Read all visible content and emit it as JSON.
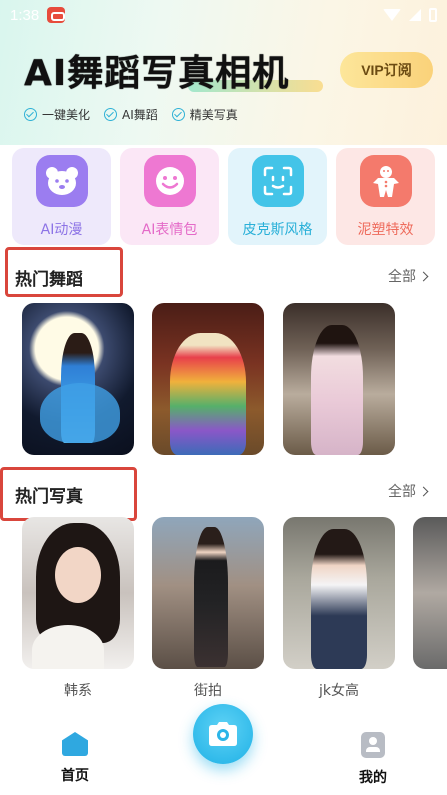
{
  "status_bar": {
    "time": "1:38"
  },
  "header": {
    "title": "AI舞蹈写真相机",
    "vip_label": "VIP订阅",
    "features": [
      "一键美化",
      "AI舞蹈",
      "精美写真"
    ]
  },
  "categories": [
    {
      "label": "AI动漫",
      "icon": "bear-face-icon"
    },
    {
      "label": "AI表情包",
      "icon": "smiley-face-icon"
    },
    {
      "label": "皮克斯风格",
      "icon": "face-scan-icon"
    },
    {
      "label": "泥塑特效",
      "icon": "gingerbread-man-icon"
    }
  ],
  "sections": {
    "dance": {
      "title": "热门舞蹈",
      "see_all": "全部"
    },
    "photo": {
      "title": "热门写真",
      "see_all": "全部"
    }
  },
  "photo_items": [
    "韩系",
    "街拍",
    "jk女高"
  ],
  "bottom_nav": {
    "home": "首页",
    "mine": "我的"
  },
  "colors": {
    "accent": "#2fa8e0",
    "highlight": "#d9463c"
  }
}
